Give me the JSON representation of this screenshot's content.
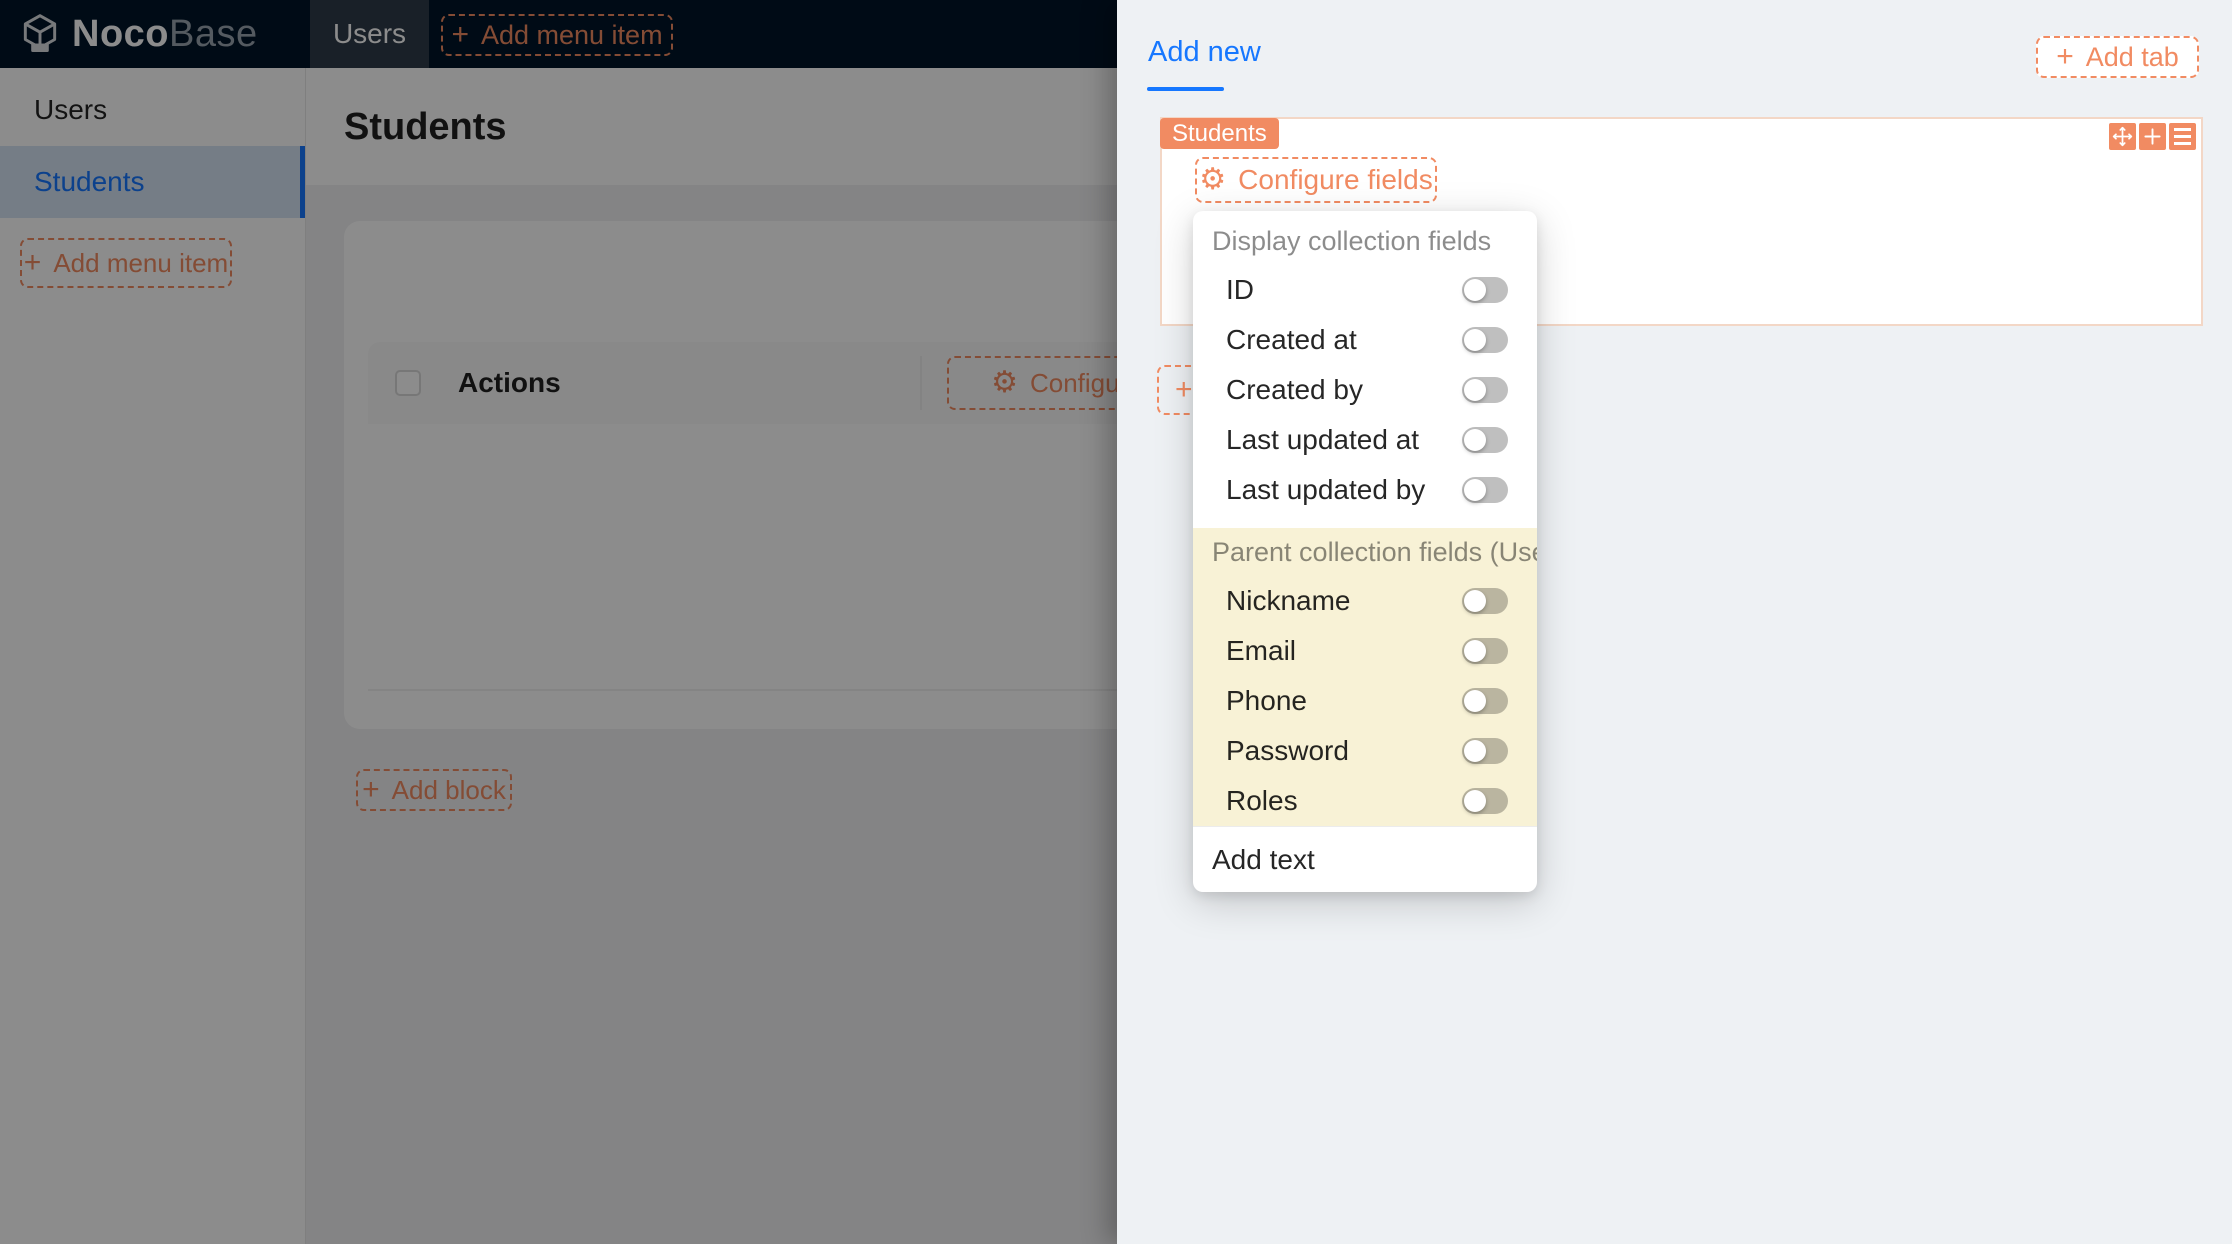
{
  "header": {
    "logo": {
      "bold": "Noco",
      "light": "Base"
    },
    "nav": [
      {
        "label": "Users"
      }
    ],
    "add_menu_item_label": "Add menu item"
  },
  "sidebar": {
    "items": [
      {
        "label": "Users",
        "active": false
      },
      {
        "label": "Students",
        "active": true
      }
    ],
    "add_menu_item_label": "Add menu item"
  },
  "main": {
    "page_title": "Students",
    "table": {
      "columns": [
        {
          "label": "Actions"
        }
      ],
      "select_all_checked": false,
      "configure_columns_label": "Configure c",
      "add_block_label": "Add block"
    }
  },
  "drawer": {
    "tabs": [
      {
        "label": "Add new",
        "active": true
      }
    ],
    "add_tab_label": "Add tab",
    "block": {
      "badge": "Students",
      "configure_fields_label": "Configure fields",
      "toolbar_icons": [
        "drag-icon",
        "plus-icon",
        "menu-icon"
      ]
    },
    "fields_menu": {
      "groups": [
        {
          "label": "Display collection fields",
          "highlighted": false,
          "items": [
            {
              "label": "ID",
              "enabled": false
            },
            {
              "label": "Created at",
              "enabled": false
            },
            {
              "label": "Created by",
              "enabled": false
            },
            {
              "label": "Last updated at",
              "enabled": false
            },
            {
              "label": "Last updated by",
              "enabled": false
            }
          ]
        },
        {
          "label": "Parent collection fields (Users)",
          "highlighted": true,
          "items": [
            {
              "label": "Nickname",
              "enabled": false
            },
            {
              "label": "Email",
              "enabled": false
            },
            {
              "label": "Phone",
              "enabled": false
            },
            {
              "label": "Password",
              "enabled": false
            },
            {
              "label": "Roles",
              "enabled": false
            }
          ]
        }
      ],
      "footer_item": "Add text"
    }
  },
  "icons": {
    "plus_glyph": "+",
    "gear_glyph": "⚙"
  },
  "colors": {
    "accent_orange": "#F18B62",
    "active_blue": "#1677FF",
    "header_bg": "#001529",
    "drawer_bg": "#EEF1F4",
    "group_highlight_yellow": "#F8F2D6"
  }
}
